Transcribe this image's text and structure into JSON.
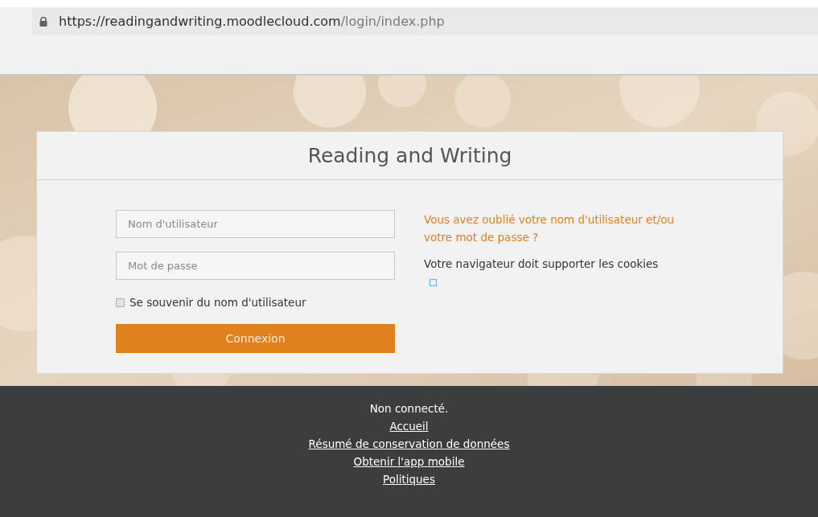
{
  "address_bar": {
    "url_host": "https://readingandwriting.moodlecloud.com",
    "url_path": "/login/index.php"
  },
  "login": {
    "title": "Reading and Writing",
    "username": {
      "placeholder": "Nom d'utilisateur"
    },
    "password": {
      "placeholder": "Mot de passe"
    },
    "remember": {
      "label": "Se souvenir du nom d'utilisateur",
      "checked": false
    },
    "submit": "Connexion",
    "forgot_link": "Vous avez oublié votre nom d'utilisateur et/ou votre mot de passe ?",
    "cookies_notice": "Votre navigateur doit supporter les cookies"
  },
  "footer": {
    "status": "Non connecté.",
    "links": [
      "Accueil",
      "Résumé de conservation de données",
      "Obtenir l'app mobile",
      "Politiques"
    ]
  }
}
